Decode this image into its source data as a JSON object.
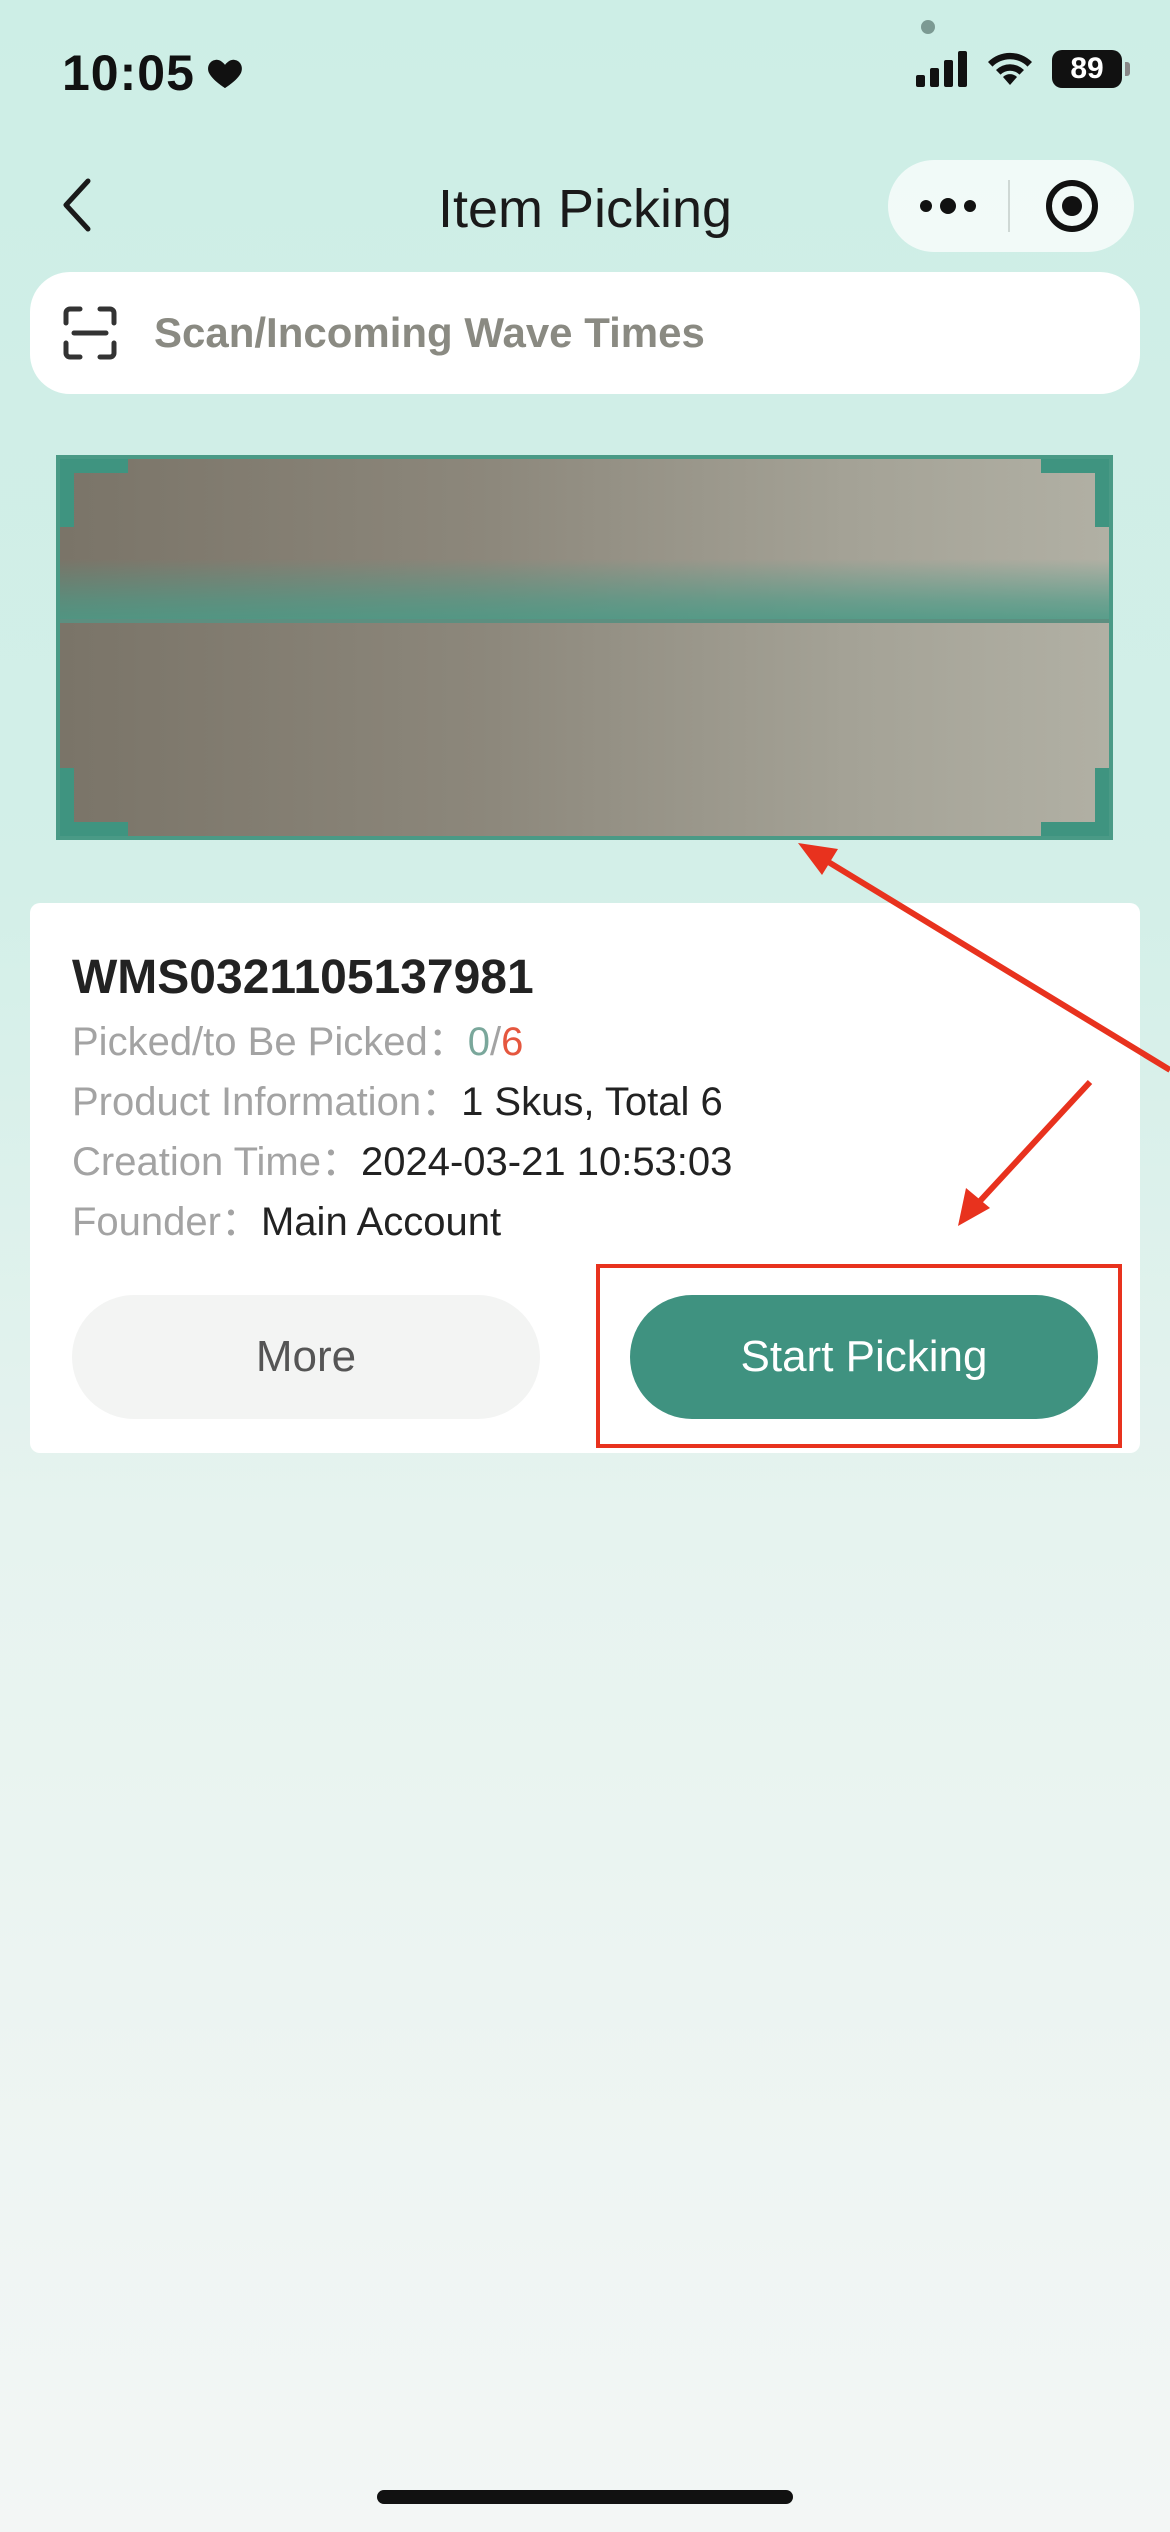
{
  "status_bar": {
    "time": "10:05",
    "battery": "89"
  },
  "nav": {
    "title": "Item Picking"
  },
  "search": {
    "placeholder": "Scan/Incoming Wave Times"
  },
  "order": {
    "order_no": "WMS0321105137981",
    "picked_label": "Picked/to Be Picked",
    "picked_value": "0",
    "picked_separator": "/",
    "to_pick_value": "6",
    "product_label": "Product Information",
    "product_value": "1 Skus, Total 6",
    "created_label": "Creation Time",
    "created_value": "2024-03-21 10:53:03",
    "founder_label": "Founder",
    "founder_value": "Main Account",
    "colon": "："
  },
  "actions": {
    "more_label": "More",
    "start_label": "Start Picking"
  },
  "colors": {
    "accent": "#3f9280",
    "to_pick": "#e5573f",
    "annotation": "#e8321e"
  }
}
